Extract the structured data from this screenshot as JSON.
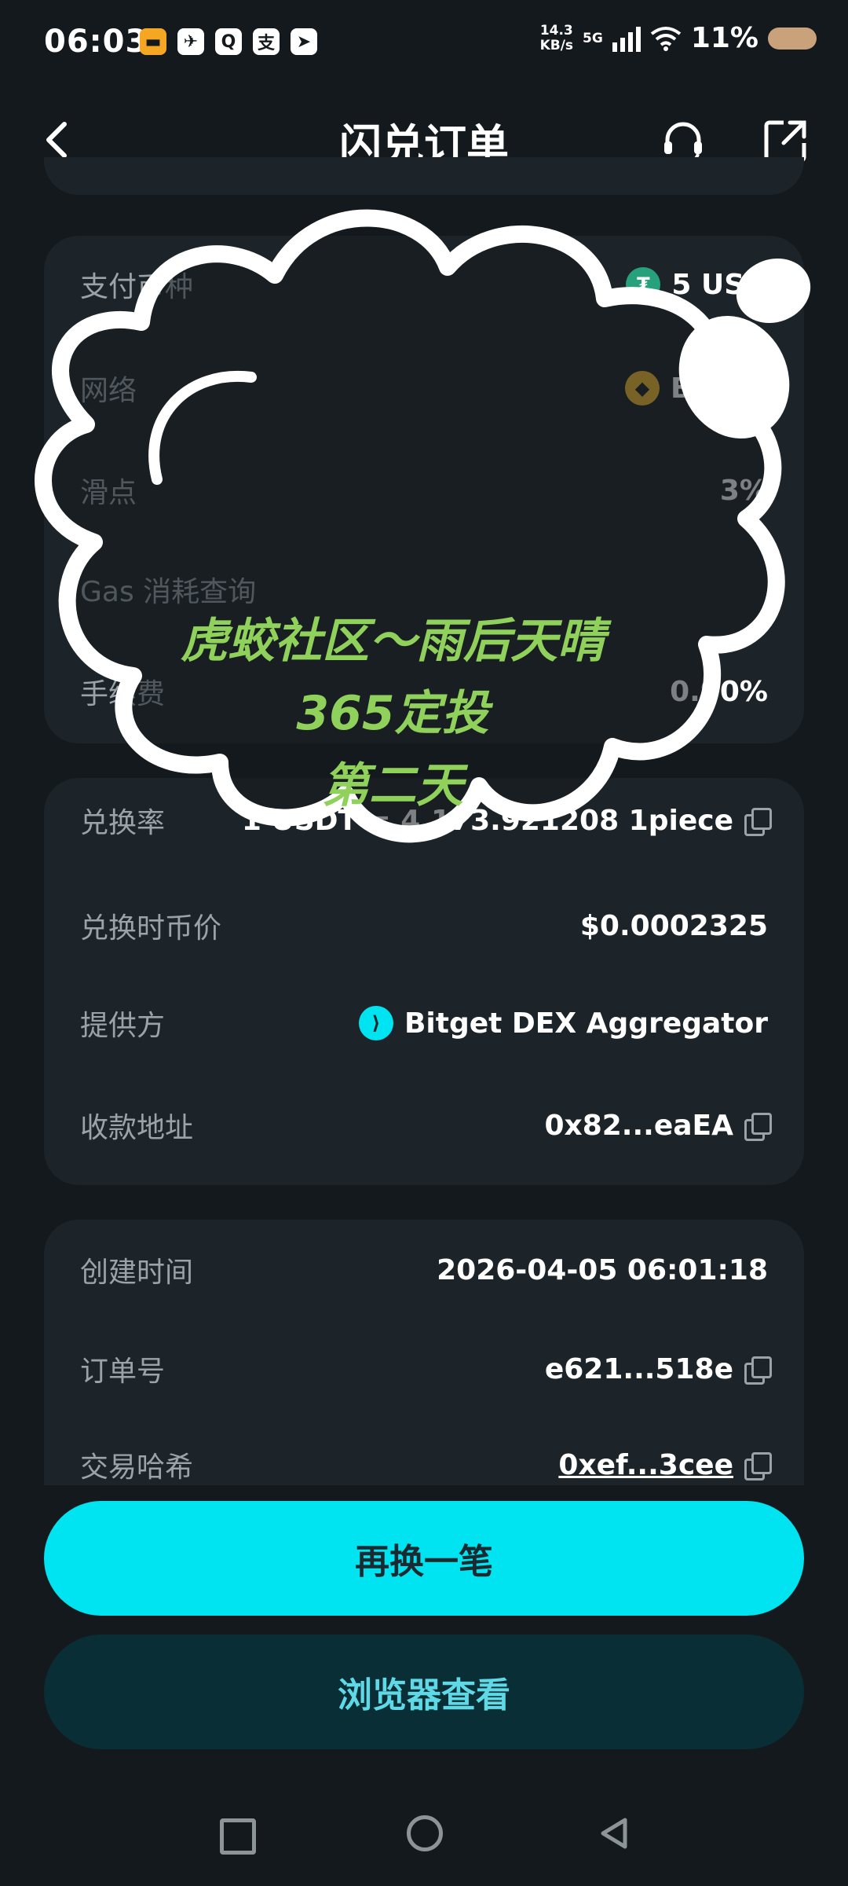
{
  "status_bar": {
    "time": "06:03",
    "speed_value": "14.3",
    "speed_unit": "KB/s",
    "network": "5G",
    "battery": "11%"
  },
  "nav": {
    "title": "闪兑订单"
  },
  "card1": {
    "rows": [
      {
        "label": "支付币种",
        "value": "5 USD"
      },
      {
        "label": "网络",
        "value": "BNB C"
      },
      {
        "label": "滑点",
        "value": "3%"
      },
      {
        "label": "Gas 消耗查询",
        "value": ""
      },
      {
        "label": "手续费",
        "value": "0.90%"
      }
    ]
  },
  "card2": {
    "rows": [
      {
        "label": "兑换率",
        "value": "1 USDT = 4,173.921208 1piece"
      },
      {
        "label": "兑换时币价",
        "value": "$0.0002325"
      },
      {
        "label": "提供方",
        "value": "Bitget DEX Aggregator"
      },
      {
        "label": "收款地址",
        "value": "0x82...eaEA"
      }
    ]
  },
  "card3": {
    "rows": [
      {
        "label": "创建时间",
        "value": "2026-04-05 06:01:18"
      },
      {
        "label": "订单号",
        "value": "e621...518e"
      },
      {
        "label": "交易哈希",
        "value": "0xef...3cee"
      }
    ]
  },
  "buttons": {
    "primary": "再换一笔",
    "secondary": "浏览器查看"
  },
  "sticker": {
    "line1": "虎蛟社区～雨后天晴",
    "line2": "365定投",
    "line3": "第二天"
  }
}
